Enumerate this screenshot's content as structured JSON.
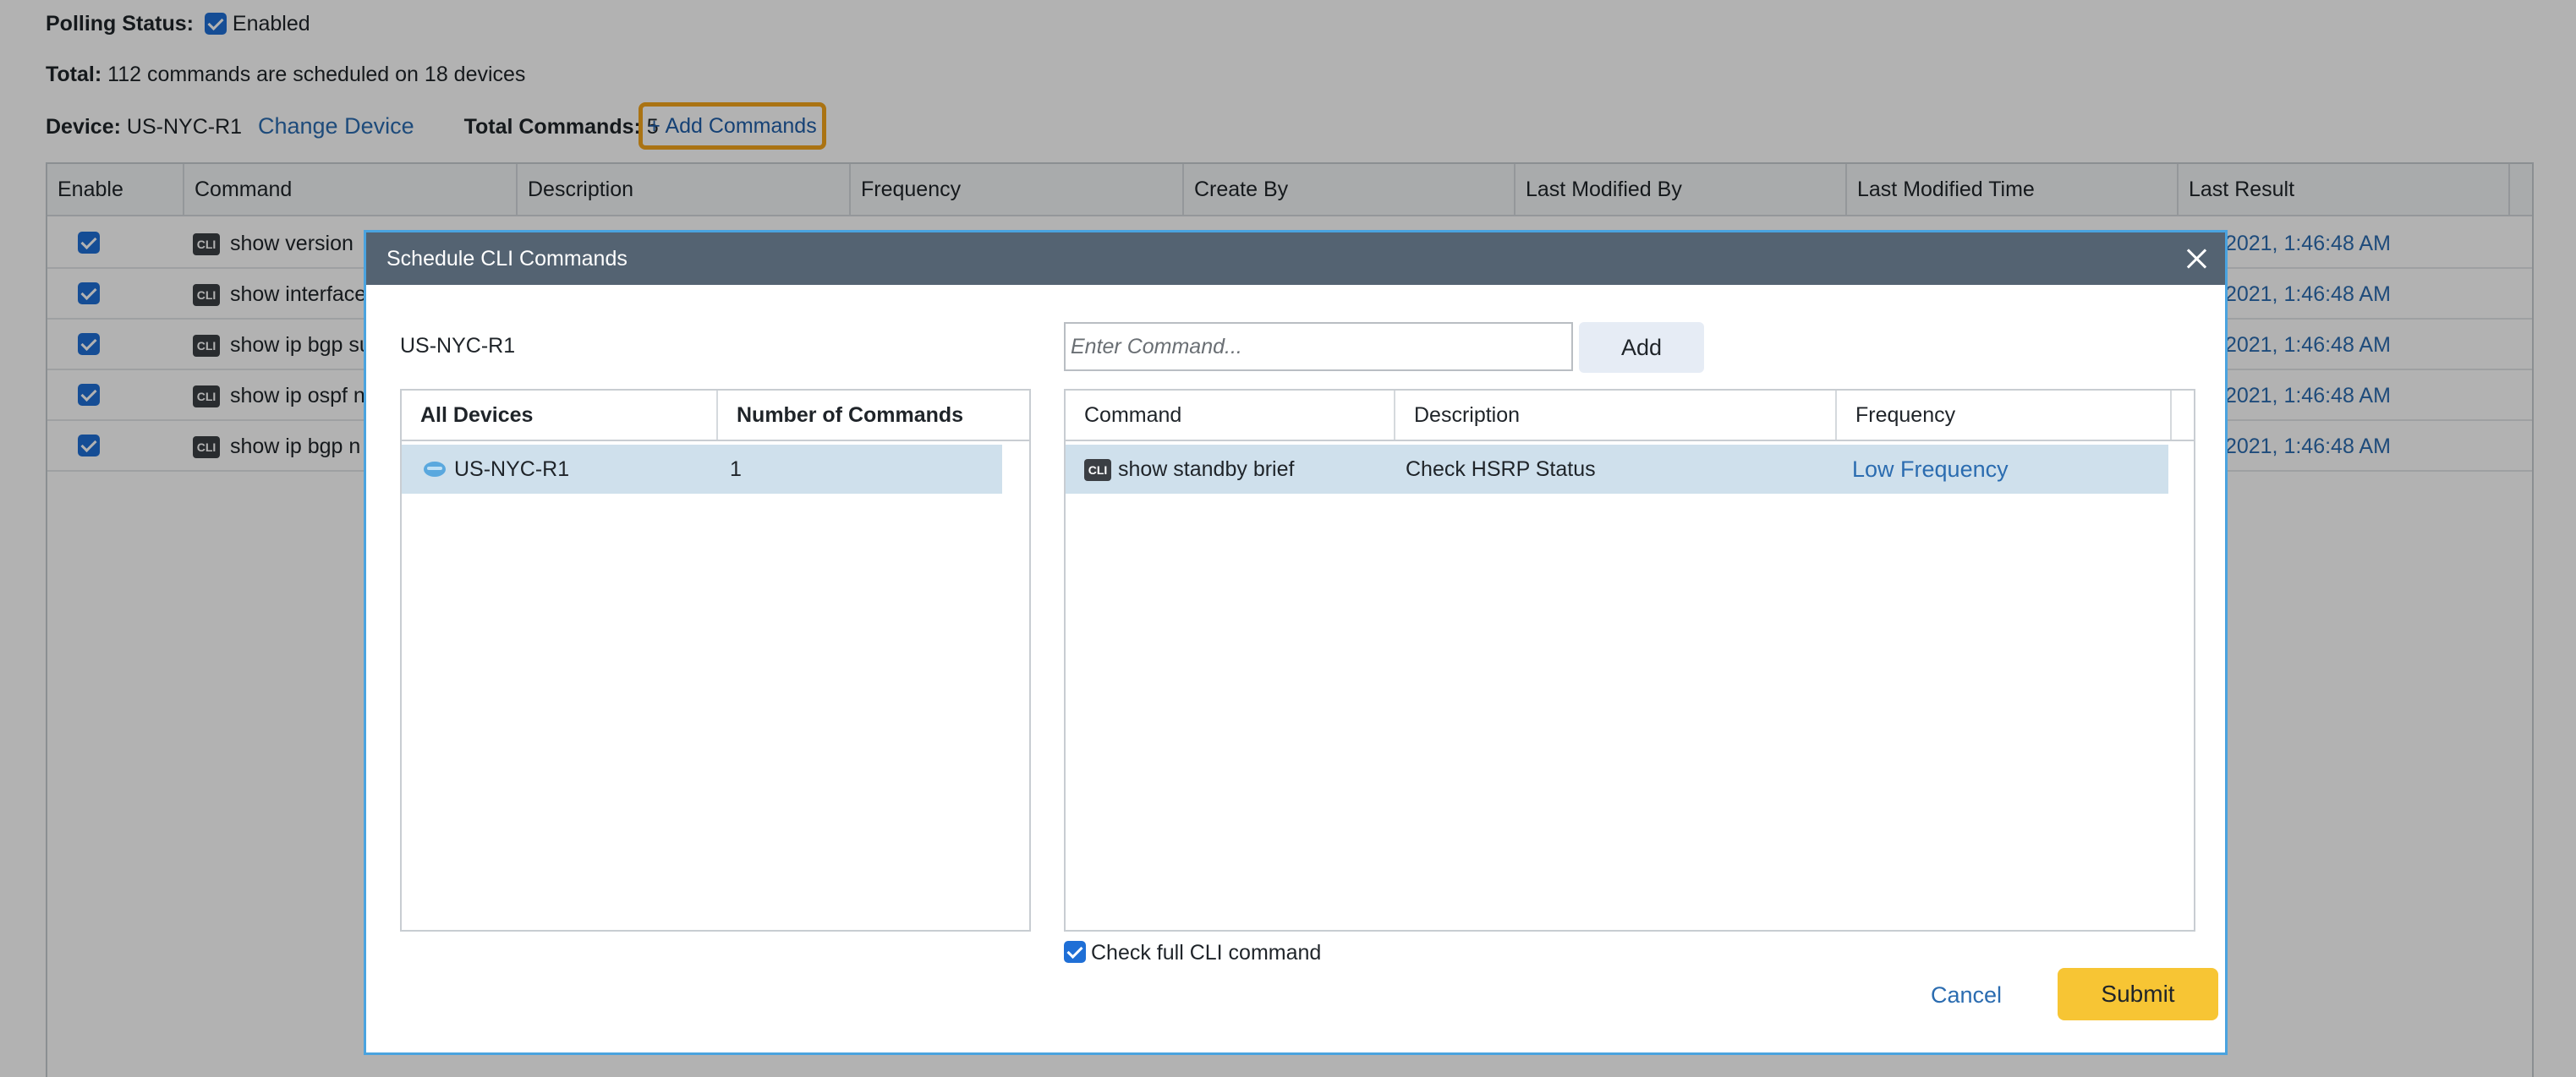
{
  "page": {
    "polling_label": "Polling Status:",
    "polling_value": "Enabled",
    "total_label": "Total:",
    "total_value": "112 commands are scheduled on 18 devices",
    "device_label": "Device:",
    "device_value": "US-NYC-R1",
    "change_device": "Change Device",
    "total_commands_label": "Total Commands:",
    "total_commands_value": "5",
    "add_commands": "+ Add Commands"
  },
  "table": {
    "headers": [
      "Enable",
      "Command",
      "Description",
      "Frequency",
      "Create By",
      "Last Modified By",
      "Last Modified Time",
      "Last Result"
    ],
    "rows": [
      {
        "command": "show version",
        "time": "/2021, 1:46:48 AM"
      },
      {
        "command": "show interface",
        "time": "/2021, 1:46:48 AM"
      },
      {
        "command": "show ip bgp su",
        "time": "/2021, 1:46:48 AM"
      },
      {
        "command": "show ip ospf n",
        "time": "/2021, 1:46:48 AM"
      },
      {
        "command": "show ip bgp n",
        "time": "/2021, 1:46:48 AM"
      }
    ],
    "cli_badge": "CLI"
  },
  "dialog": {
    "title": "Schedule CLI Commands",
    "device": "US-NYC-R1",
    "input_placeholder": "Enter Command...",
    "add_label": "Add",
    "left_headers": [
      "All Devices",
      "Number of Commands"
    ],
    "left_rows": [
      {
        "device": "US-NYC-R1",
        "count": "1"
      }
    ],
    "right_headers": [
      "Command",
      "Description",
      "Frequency"
    ],
    "right_rows": [
      {
        "command": "show standby brief",
        "description": "Check HSRP Status",
        "frequency": "Low Frequency"
      }
    ],
    "check_full_cli": "Check full CLI command",
    "cancel_label": "Cancel",
    "submit_label": "Submit"
  },
  "colors": {
    "accent_blue": "#2b6cb0",
    "header_dark": "#546372",
    "submit_yellow": "#f7c534",
    "highlight_orange": "#f4a51c",
    "selected_row": "#cfe0ec"
  }
}
